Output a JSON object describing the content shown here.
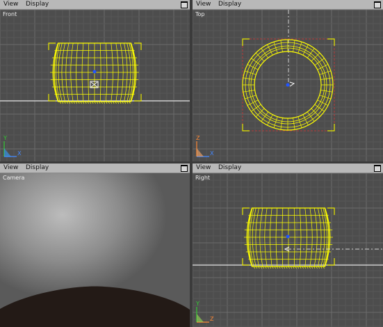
{
  "viewports": {
    "front": {
      "label": "Front",
      "menu": {
        "view": "View",
        "display": "Display"
      },
      "axis_x": "X",
      "axis_y": "Y"
    },
    "top": {
      "label": "Top",
      "menu": {
        "view": "View",
        "display": "Display"
      },
      "axis_x": "X",
      "axis_y": "Z"
    },
    "camera": {
      "label": "Camera",
      "menu": {
        "view": "View",
        "display": "Display"
      }
    },
    "right": {
      "label": "Right",
      "menu": {
        "view": "View",
        "display": "Display"
      },
      "axis_x": "Z",
      "axis_y": "Y"
    }
  },
  "colors": {
    "viewport_bg": "#4d4d4d",
    "grid_minor": "#575757",
    "grid_major": "#6b6b6b",
    "wireframe": "#ffff00",
    "selection_bracket": "#e8e800",
    "ground_line": "#e6e6e6",
    "gizmo_blue": "#2255ff",
    "axis_y": "#33cc33",
    "axis_x": "#4488ff",
    "axis_z": "#ff8833",
    "camera_ground": "#231a16"
  }
}
